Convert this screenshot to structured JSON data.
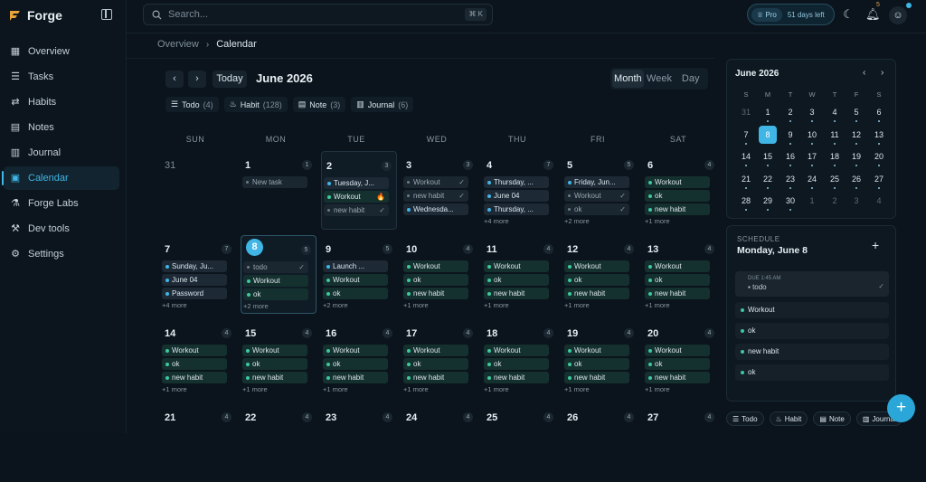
{
  "app": {
    "name": "Forge"
  },
  "search": {
    "placeholder": "Search...",
    "shortcut": "⌘ K"
  },
  "pro": {
    "label": "Pro",
    "days_left": "51 days left"
  },
  "notifications": {
    "count": "5"
  },
  "sidebar": {
    "items": [
      {
        "label": "Overview",
        "icon": "overview-icon"
      },
      {
        "label": "Tasks",
        "icon": "tasks-icon"
      },
      {
        "label": "Habits",
        "icon": "habits-icon"
      },
      {
        "label": "Notes",
        "icon": "notes-icon"
      },
      {
        "label": "Journal",
        "icon": "journal-icon"
      },
      {
        "label": "Calendar",
        "icon": "calendar-icon",
        "active": true
      },
      {
        "label": "Forge Labs",
        "icon": "flask-icon"
      },
      {
        "label": "Dev tools",
        "icon": "wrench-icon"
      },
      {
        "label": "Settings",
        "icon": "gear-icon"
      }
    ]
  },
  "breadcrumb": {
    "root": "Overview",
    "current": "Calendar"
  },
  "calendar": {
    "today_label": "Today",
    "title": "June 2026",
    "views": [
      "Month",
      "Week",
      "Day"
    ],
    "active_view": "Month",
    "filters": [
      {
        "label": "Todo",
        "count": "(4)"
      },
      {
        "label": "Habit",
        "count": "(128)"
      },
      {
        "label": "Note",
        "count": "(3)"
      },
      {
        "label": "Journal",
        "count": "(6)"
      }
    ],
    "weekdays": [
      "SUN",
      "MON",
      "TUE",
      "WED",
      "THU",
      "FRI",
      "SAT"
    ],
    "weeks": [
      [
        {
          "day": "31",
          "dim": true,
          "count": "",
          "events": [],
          "more": ""
        },
        {
          "day": "1",
          "count": "1",
          "events": [
            {
              "t": "New task",
              "k": "todo"
            }
          ],
          "more": ""
        },
        {
          "day": "2",
          "count": "3",
          "sel": true,
          "events": [
            {
              "t": "Tuesday, J...",
              "k": "note"
            },
            {
              "t": "Workout",
              "k": "habit",
              "c": "🔥"
            },
            {
              "t": "new habit",
              "k": "todo",
              "c": "✓"
            }
          ],
          "more": ""
        },
        {
          "day": "3",
          "count": "3",
          "events": [
            {
              "t": "Workout",
              "k": "todo",
              "c": "✓"
            },
            {
              "t": "new habit",
              "k": "todo",
              "c": "✓"
            },
            {
              "t": "Wednesda...",
              "k": "note"
            }
          ],
          "more": ""
        },
        {
          "day": "4",
          "count": "7",
          "events": [
            {
              "t": "Thursday, ...",
              "k": "note"
            },
            {
              "t": "June 04",
              "k": "note"
            },
            {
              "t": "Thursday, ...",
              "k": "note"
            }
          ],
          "more": "+4 more"
        },
        {
          "day": "5",
          "count": "5",
          "events": [
            {
              "t": "Friday, Jun...",
              "k": "note"
            },
            {
              "t": "Workout",
              "k": "todo",
              "c": "✓"
            },
            {
              "t": "ok",
              "k": "todo",
              "c": "✓"
            }
          ],
          "more": "+2 more"
        },
        {
          "day": "6",
          "count": "4",
          "events": [
            {
              "t": "Workout",
              "k": "habit"
            },
            {
              "t": "ok",
              "k": "habit"
            },
            {
              "t": "new habit",
              "k": "habit"
            }
          ],
          "more": "+1 more"
        }
      ],
      [
        {
          "day": "7",
          "count": "7",
          "events": [
            {
              "t": "Sunday, Ju...",
              "k": "note"
            },
            {
              "t": "June 04",
              "k": "note"
            },
            {
              "t": "Password",
              "k": "note"
            }
          ],
          "more": "+4 more"
        },
        {
          "day": "8",
          "count": "5",
          "cur": true,
          "events": [
            {
              "t": "todo",
              "k": "todo",
              "c": "✓"
            },
            {
              "t": "Workout",
              "k": "habit"
            },
            {
              "t": "ok",
              "k": "habit"
            }
          ],
          "more": "+2 more"
        },
        {
          "day": "9",
          "count": "5",
          "events": [
            {
              "t": "Launch ...",
              "k": "note"
            },
            {
              "t": "Workout",
              "k": "habit"
            },
            {
              "t": "ok",
              "k": "habit"
            }
          ],
          "more": "+2 more"
        },
        {
          "day": "10",
          "count": "4",
          "events": [
            {
              "t": "Workout",
              "k": "habit"
            },
            {
              "t": "ok",
              "k": "habit"
            },
            {
              "t": "new habit",
              "k": "habit"
            }
          ],
          "more": "+1 more"
        },
        {
          "day": "11",
          "count": "4",
          "events": [
            {
              "t": "Workout",
              "k": "habit"
            },
            {
              "t": "ok",
              "k": "habit"
            },
            {
              "t": "new habit",
              "k": "habit"
            }
          ],
          "more": "+1 more"
        },
        {
          "day": "12",
          "count": "4",
          "events": [
            {
              "t": "Workout",
              "k": "habit"
            },
            {
              "t": "ok",
              "k": "habit"
            },
            {
              "t": "new habit",
              "k": "habit"
            }
          ],
          "more": "+1 more"
        },
        {
          "day": "13",
          "count": "4",
          "events": [
            {
              "t": "Workout",
              "k": "habit"
            },
            {
              "t": "ok",
              "k": "habit"
            },
            {
              "t": "new habit",
              "k": "habit"
            }
          ],
          "more": "+1 more"
        }
      ],
      [
        {
          "day": "14",
          "count": "4",
          "events": [
            {
              "t": "Workout",
              "k": "habit"
            },
            {
              "t": "ok",
              "k": "habit"
            },
            {
              "t": "new habit",
              "k": "habit"
            }
          ],
          "more": "+1 more"
        },
        {
          "day": "15",
          "count": "4",
          "events": [
            {
              "t": "Workout",
              "k": "habit"
            },
            {
              "t": "ok",
              "k": "habit"
            },
            {
              "t": "new habit",
              "k": "habit"
            }
          ],
          "more": "+1 more"
        },
        {
          "day": "16",
          "count": "4",
          "events": [
            {
              "t": "Workout",
              "k": "habit"
            },
            {
              "t": "ok",
              "k": "habit"
            },
            {
              "t": "new habit",
              "k": "habit"
            }
          ],
          "more": "+1 more"
        },
        {
          "day": "17",
          "count": "4",
          "events": [
            {
              "t": "Workout",
              "k": "habit"
            },
            {
              "t": "ok",
              "k": "habit"
            },
            {
              "t": "new habit",
              "k": "habit"
            }
          ],
          "more": "+1 more"
        },
        {
          "day": "18",
          "count": "4",
          "events": [
            {
              "t": "Workout",
              "k": "habit"
            },
            {
              "t": "ok",
              "k": "habit"
            },
            {
              "t": "new habit",
              "k": "habit"
            }
          ],
          "more": "+1 more"
        },
        {
          "day": "19",
          "count": "4",
          "events": [
            {
              "t": "Workout",
              "k": "habit"
            },
            {
              "t": "ok",
              "k": "habit"
            },
            {
              "t": "new habit",
              "k": "habit"
            }
          ],
          "more": "+1 more"
        },
        {
          "day": "20",
          "count": "4",
          "events": [
            {
              "t": "Workout",
              "k": "habit"
            },
            {
              "t": "ok",
              "k": "habit"
            },
            {
              "t": "new habit",
              "k": "habit"
            }
          ],
          "more": "+1 more"
        }
      ],
      [
        {
          "day": "21",
          "count": "4",
          "events": [],
          "more": ""
        },
        {
          "day": "22",
          "count": "4",
          "events": [],
          "more": ""
        },
        {
          "day": "23",
          "count": "4",
          "events": [],
          "more": ""
        },
        {
          "day": "24",
          "count": "4",
          "events": [],
          "more": ""
        },
        {
          "day": "25",
          "count": "4",
          "events": [],
          "more": ""
        },
        {
          "day": "26",
          "count": "4",
          "events": [],
          "more": ""
        },
        {
          "day": "27",
          "count": "4",
          "events": [],
          "more": ""
        }
      ]
    ]
  },
  "mini_calendar": {
    "title": "June 2026",
    "weekdays": [
      "S",
      "M",
      "T",
      "W",
      "T",
      "F",
      "S"
    ],
    "days": [
      {
        "d": "31",
        "dim": true
      },
      {
        "d": "1",
        "dot": true
      },
      {
        "d": "2",
        "dot": true
      },
      {
        "d": "3",
        "dot": true
      },
      {
        "d": "4",
        "dot": true
      },
      {
        "d": "5",
        "dot": true
      },
      {
        "d": "6",
        "dot": true
      },
      {
        "d": "7",
        "dot": true
      },
      {
        "d": "8",
        "sel": true
      },
      {
        "d": "9",
        "dot": true
      },
      {
        "d": "10",
        "dot": true
      },
      {
        "d": "11",
        "dot": true
      },
      {
        "d": "12",
        "dot": true
      },
      {
        "d": "13",
        "dot": true
      },
      {
        "d": "14",
        "dot": true
      },
      {
        "d": "15",
        "dot": true
      },
      {
        "d": "16",
        "dot": true
      },
      {
        "d": "17",
        "dot": true
      },
      {
        "d": "18",
        "dot": true
      },
      {
        "d": "19",
        "dot": true
      },
      {
        "d": "20",
        "dot": true
      },
      {
        "d": "21",
        "dot": true
      },
      {
        "d": "22",
        "dot": true
      },
      {
        "d": "23",
        "dot": true
      },
      {
        "d": "24",
        "dot": true
      },
      {
        "d": "25",
        "dot": true
      },
      {
        "d": "26",
        "dot": true
      },
      {
        "d": "27",
        "dot": true
      },
      {
        "d": "28",
        "dot": true
      },
      {
        "d": "29",
        "dot": true
      },
      {
        "d": "30",
        "dot": true
      },
      {
        "d": "1",
        "dim": true
      },
      {
        "d": "2",
        "dim": true
      },
      {
        "d": "3",
        "dim": true
      },
      {
        "d": "4",
        "dim": true
      }
    ]
  },
  "schedule": {
    "label": "SCHEDULE",
    "day": "Monday, June 8",
    "todo": {
      "due": "DUE  1:45 AM",
      "text": "todo"
    },
    "habits": [
      "Workout",
      "ok",
      "new habit",
      "ok"
    ]
  },
  "quick_add": [
    "Todo",
    "Habit",
    "Note",
    "Journal"
  ],
  "colors": {
    "accent": "#3fb6e6",
    "habit": "#3ec7a0",
    "background": "#0b141c"
  }
}
